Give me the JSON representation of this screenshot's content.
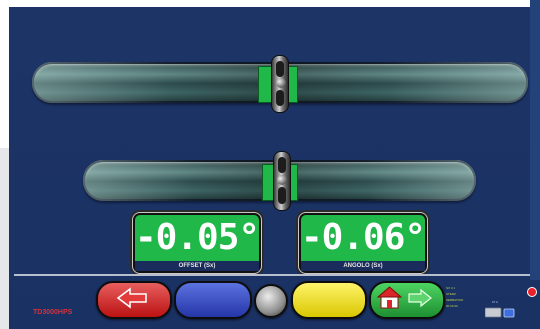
{
  "readouts": [
    {
      "value": "-0.05°",
      "label": "OFFSET (Sx)"
    },
    {
      "value": "-0.06°",
      "label": "ANGOLO (Sx)"
    }
  ],
  "footer": {
    "model": "TD3000HPS",
    "info_lines": [
      "SX 4 1",
      "STERZ",
      "SERBATOIO",
      "00 00 00"
    ],
    "small_label": "97 A"
  },
  "buttons": {
    "back": "arrow-left-icon",
    "home": "home-icon",
    "forward": "arrow-right-icon"
  },
  "colors": {
    "background": "#1d3467",
    "readout_green": "#21b84a",
    "back_red": "#c51b1b",
    "action_blue": "#2f43b6",
    "action_yellow": "#f2e21c",
    "home_green": "#2aa83e"
  }
}
